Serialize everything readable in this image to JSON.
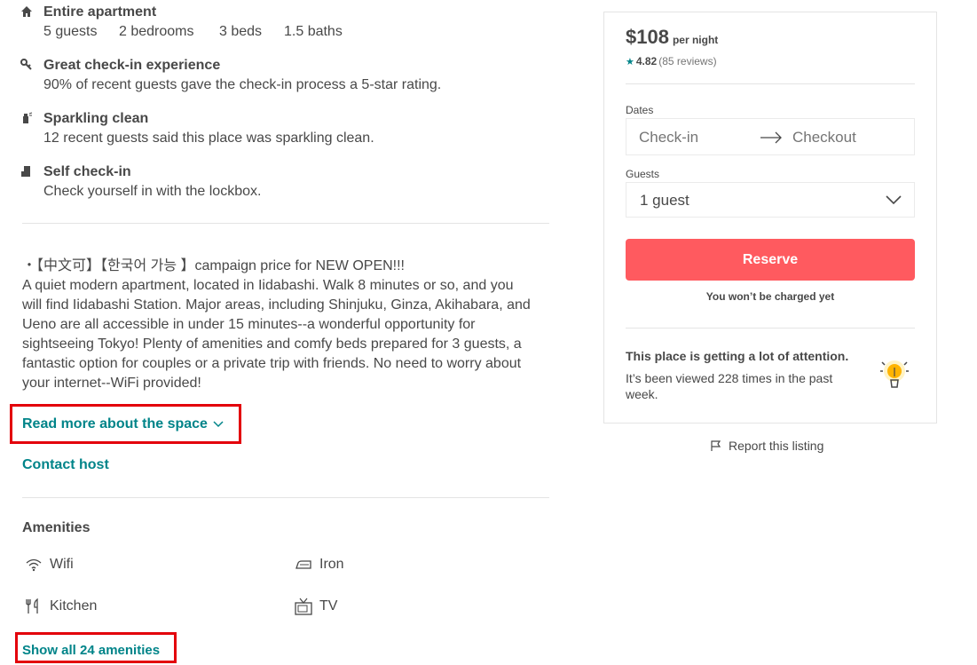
{
  "highlights": [
    {
      "title": "Entire apartment",
      "details": [
        "5 guests",
        "2 bedrooms",
        "3 beds",
        "1.5 baths"
      ]
    },
    {
      "title": "Great check-in experience",
      "subtitle": "90% of recent guests gave the check-in process a 5-star rating."
    },
    {
      "title": "Sparkling clean",
      "subtitle": "12 recent guests said this place was sparkling clean."
    },
    {
      "title": "Self check-in",
      "subtitle": "Check yourself in with the lockbox."
    }
  ],
  "description": {
    "lines": [
      "・【中文可】【한국어 가능 】campaign price for NEW OPEN!!!",
      "A quiet modern apartment, located in Iidabashi. Walk 8 minutes or so, and you",
      "will find Iidabashi Station. Major areas, including Shinjuku, Ginza, Akihabara, and",
      "Ueno are all accessible in under 15 minutes--a wonderful opportunity for",
      "sightseeing Tokyo! Plenty of amenities and comfy beds prepared for 3 guests, a",
      "fantastic option for couples or a private trip with friends. No need to worry about",
      "your internet--WiFi provided!"
    ],
    "read_more": "Read more about the space",
    "contact_host": "Contact host"
  },
  "amenities": {
    "heading": "Amenities",
    "items": [
      {
        "label": "Wifi",
        "icon": "wifi-icon"
      },
      {
        "label": "Iron",
        "icon": "iron-icon"
      },
      {
        "label": "Kitchen",
        "icon": "kitchen-icon"
      },
      {
        "label": "TV",
        "icon": "tv-icon"
      }
    ],
    "show_all": "Show all 24 amenities"
  },
  "booking": {
    "price": "$108",
    "per_night": "per night",
    "rating": "4.82",
    "reviews": "(85 reviews)",
    "dates_label": "Dates",
    "checkin_placeholder": "Check-in",
    "checkout_placeholder": "Checkout",
    "guests_label": "Guests",
    "guests_value": "1 guest",
    "reserve": "Reserve",
    "not_charged": "You won’t be charged yet",
    "attention_title": "This place is getting a lot of attention.",
    "attention_body": "It’s been viewed 228 times in the past week."
  },
  "report": "Report this listing",
  "colors": {
    "accent": "#008489",
    "reserve": "#ff5a5f",
    "highlight_box": "#e3000b"
  }
}
